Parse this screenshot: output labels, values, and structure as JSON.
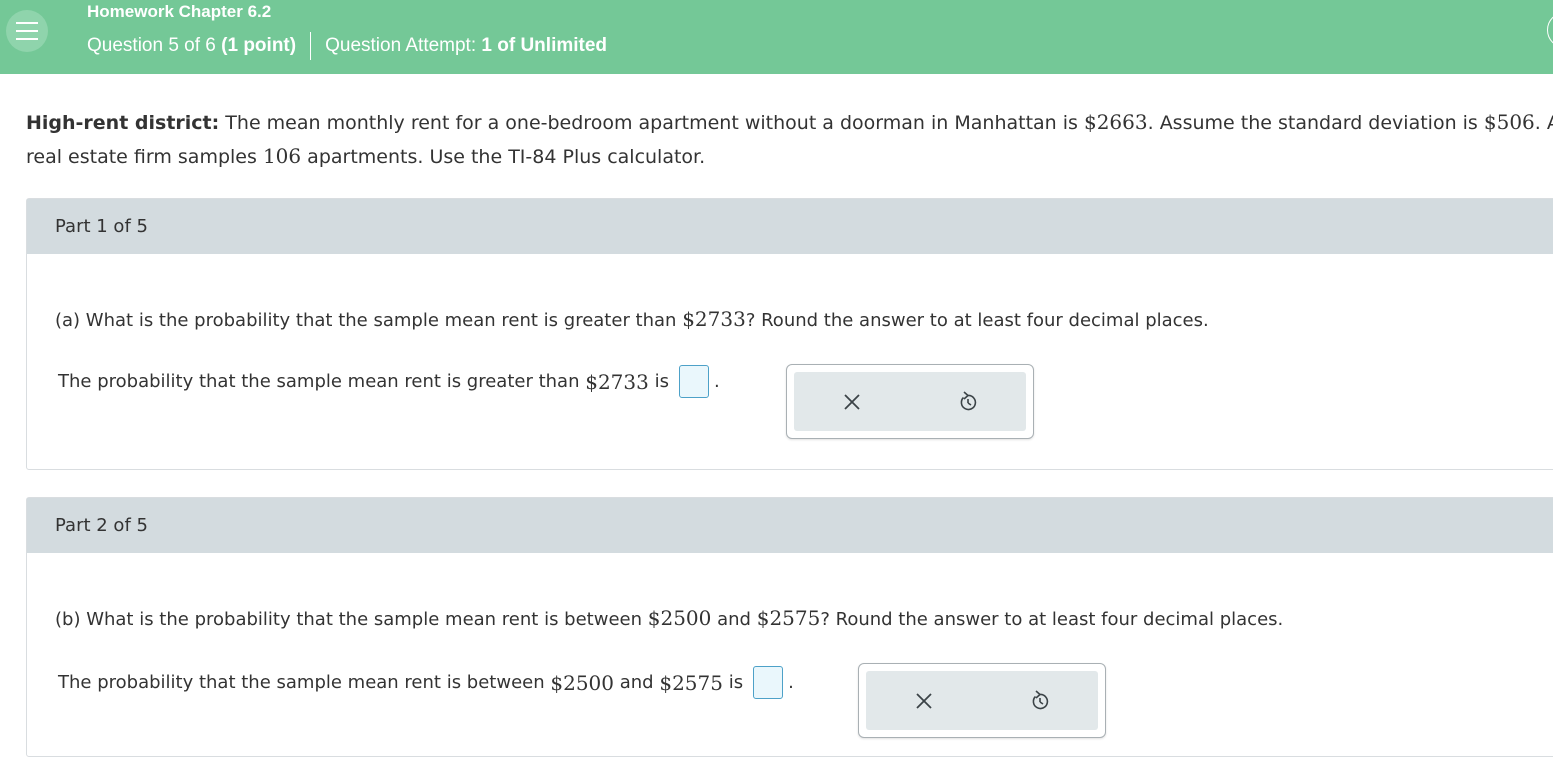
{
  "header": {
    "title": "Homework Chapter 6.2",
    "question_prefix": "Question 5 of 6",
    "question_points": "(1 point)",
    "attempt_prefix": "Question Attempt:",
    "attempt_value": "1 of Unlimited"
  },
  "intro": {
    "label": "High-rent district:",
    "t1": "The mean monthly rent for a one-bedroom apartment without a doorman in Manhattan is",
    "mean": "$2663",
    "t2": ". Assume the standard deviation is",
    "sd": "$506",
    "t3": ". A",
    "t4": "real estate firm samples",
    "n": "106",
    "t5": "apartments. Use the TI-84 Plus calculator."
  },
  "parts": [
    {
      "header": "Part 1 of 5",
      "q_prefix": "(a) What is the probability that the sample mean rent is greater than",
      "q_value": "$2733",
      "q_suffix": "? Round the answer to at least four decimal places.",
      "a_prefix": "The probability that the sample mean rent is greater than",
      "a_value": "$2733",
      "a_suffix": "is",
      "answer_value": ""
    },
    {
      "header": "Part 2 of 5",
      "q_prefix": "(b) What is the probability that the sample mean rent is between",
      "q_value1": "$2500",
      "q_and": "and",
      "q_value2": "$2575",
      "q_suffix": "? Round the answer to at least four decimal places.",
      "a_prefix": "The probability that the sample mean rent is between",
      "a_value1": "$2500",
      "a_and": "and",
      "a_value2": "$2575",
      "a_suffix": "is",
      "answer_value": ""
    }
  ],
  "punct": {
    "period": "."
  },
  "icons": {
    "menu": "hamburger-menu-icon",
    "clear": "close-x-icon",
    "undo": "undo-icon"
  },
  "colors": {
    "header_bg": "#74c897",
    "part_header_bg": "#d3dbdf",
    "answer_box_border": "#4da1c8",
    "tool_bg": "#e2e8ea"
  }
}
